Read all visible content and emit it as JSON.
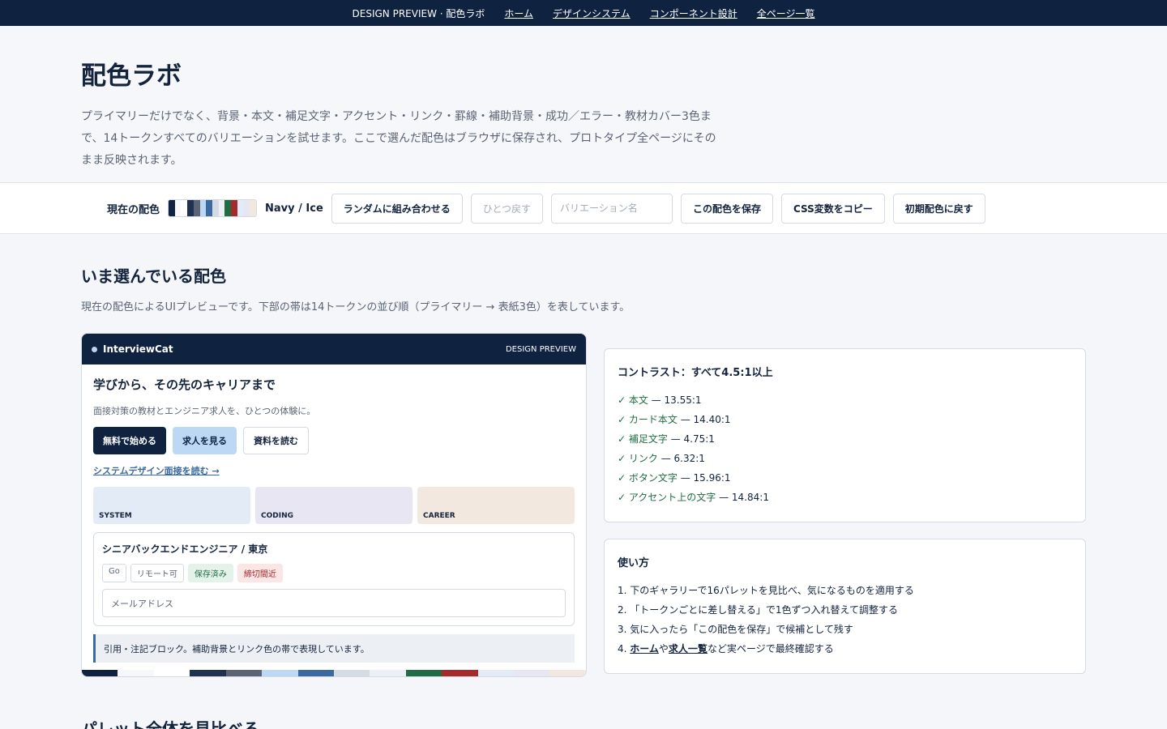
{
  "nav": {
    "brand": "DESIGN PREVIEW · 配色ラボ",
    "links": [
      "ホーム",
      "デザインシステム",
      "コンポーネント設計",
      "全ページ一覧"
    ]
  },
  "hero": {
    "title": "配色ラボ",
    "desc": "プライマリーだけでなく、背景・本文・補足文字・アクセント・リンク・罫線・補助背景・成功／エラー・教材カバー3色まで、14トークンすべてのバリエーションを試せます。ここで選んだ配色はブラウザに保存され、プロトタイプ全ページにそのまま反映されます。"
  },
  "toolbar": {
    "current_label": "現在の配色",
    "palette_name": "Navy / Ice",
    "swatches": [
      "#0f2240",
      "#f5f7fa",
      "#ffffff",
      "#1e3150",
      "#5a6475",
      "#bcd8f5",
      "#3b6aa0",
      "#d5dbe3",
      "#ecf0f5",
      "#216c44",
      "#a62a2a",
      "#e3ebf6",
      "#e9e6f4",
      "#f3e8df"
    ],
    "random_label": "ランダムに組み合わせる",
    "undo_label": "ひとつ戻す",
    "variation_placeholder": "バリエーション名",
    "save_label": "この配色を保存",
    "copy_label": "CSS変数をコピー",
    "reset_label": "初期配色に戻す"
  },
  "section": {
    "title": "いま選んでいる配色",
    "desc": "現在の配色によるUIプレビューです。下部の帯は14トークンの並び順（プライマリー → 表紙3色）を表しています。"
  },
  "preview": {
    "logo": "InterviewCat",
    "tag": "DESIGN PREVIEW",
    "heading": "学びから、その先のキャリアまで",
    "sub": "面接対策の教材とエンジニア求人を、ひとつの体験に。",
    "btn_primary": "無料で始める",
    "btn_secondary": "求人を見る",
    "btn_ghost": "資料を読む",
    "link": "システムデザイン面接を読む →",
    "covers": [
      "SYSTEM",
      "CODING",
      "CAREER"
    ],
    "job_title": "シニアバックエンドエンジニア / 東京",
    "chips": [
      "Go",
      "リモート可",
      "保存済み",
      "締切間近"
    ],
    "mail_placeholder": "メールアドレス",
    "quote": "引用・注記ブロック。補助背景とリンク色の帯で表現しています。"
  },
  "contrast": {
    "title": "コントラスト：すべて4.5:1以上",
    "items": [
      {
        "name": "本文",
        "value": "13.55:1"
      },
      {
        "name": "カード本文",
        "value": "14.40:1"
      },
      {
        "name": "補足文字",
        "value": "4.75:1"
      },
      {
        "name": "リンク",
        "value": "6.32:1"
      },
      {
        "name": "ボタン文字",
        "value": "15.96:1"
      },
      {
        "name": "アクセント上の文字",
        "value": "14.84:1"
      }
    ]
  },
  "howto": {
    "title": "使い方",
    "step1": "1. 下のギャラリーで16パレットを見比べ、気になるものを適用する",
    "step2": "2. 「トークンごとに差し替える」で1色ずつ入れ替えて調整する",
    "step3": "3. 気に入ったら「この配色を保存」で候補として残す",
    "step4_prefix": "4. ",
    "step4_link1": "ホーム",
    "step4_mid": "や",
    "step4_link2": "求人一覧",
    "step4_suffix": "など実ページで最終確認する"
  },
  "next_section": {
    "title": "パレット全体を見比べる"
  }
}
